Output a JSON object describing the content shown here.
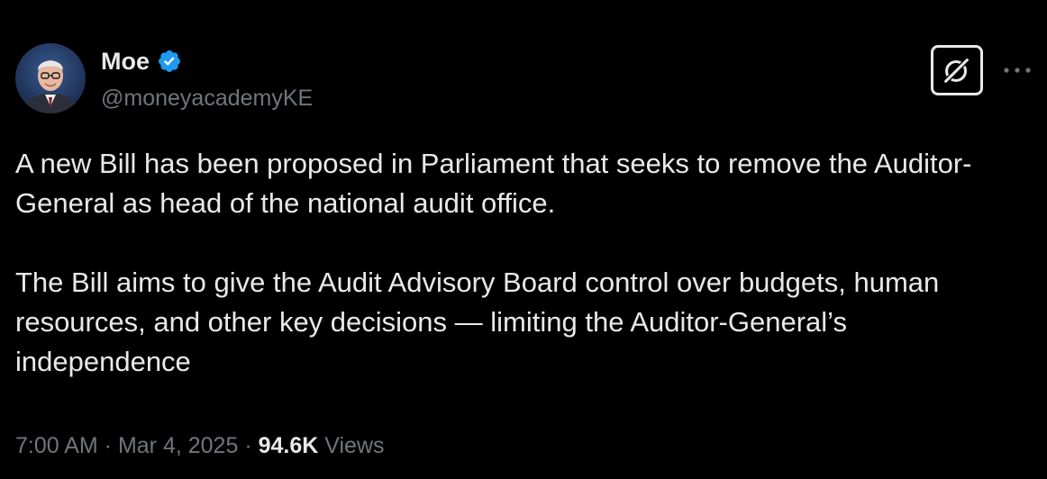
{
  "author": {
    "name": "Moe",
    "handle": "@moneyacademyKE",
    "verified": true
  },
  "icons": {
    "avatar": "profile-photo",
    "verified": "verified-badge-icon",
    "grok": "grok-icon",
    "more": "more-icon"
  },
  "colors": {
    "background": "#000000",
    "text_primary": "#e7e9ea",
    "text_secondary": "#71767b",
    "verified_blue": "#1d9bf0"
  },
  "tweet": {
    "paragraphs": [
      "A new Bill has been proposed in Parliament that seeks to remove the Auditor-General as head of the national audit office.",
      "The Bill aims to give the Audit Advisory Board control over budgets, human resources, and other key decisions — limiting the Auditor-General’s independence"
    ]
  },
  "meta": {
    "time": "7:00 AM",
    "separator": " · ",
    "date": "Mar 4, 2025",
    "views_count": "94.6K",
    "views_label": " Views"
  }
}
